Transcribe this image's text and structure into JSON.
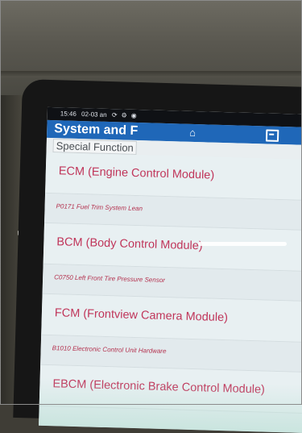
{
  "status_bar": {
    "time": "15:46",
    "date": "02-03 an",
    "icons": [
      "sync-icon",
      "settings-icon",
      "record-icon"
    ]
  },
  "header": {
    "title": "System and F",
    "home_icon": "home-icon",
    "report_icon": "edit-note-icon",
    "color": "#1f67b8"
  },
  "subtitle": "Special Function",
  "list": [
    {
      "type": "module",
      "label": "ECM (Engine Control Module)"
    },
    {
      "type": "dtc",
      "label": "P0171 Fuel Trim System Lean"
    },
    {
      "type": "module",
      "label": "BCM (Body Control Module)"
    },
    {
      "type": "dtc",
      "label": "C0750 Left Front Tire Pressure Sensor"
    },
    {
      "type": "module",
      "label": "FCM (Frontview Camera Module)"
    },
    {
      "type": "dtc",
      "label": "B1010 Electronic Control Unit Hardware"
    },
    {
      "type": "module",
      "label": "EBCM (Electronic Brake Control Module)"
    }
  ],
  "colors": {
    "module_text": "#c0355a",
    "dtc_text": "#b4324f"
  }
}
